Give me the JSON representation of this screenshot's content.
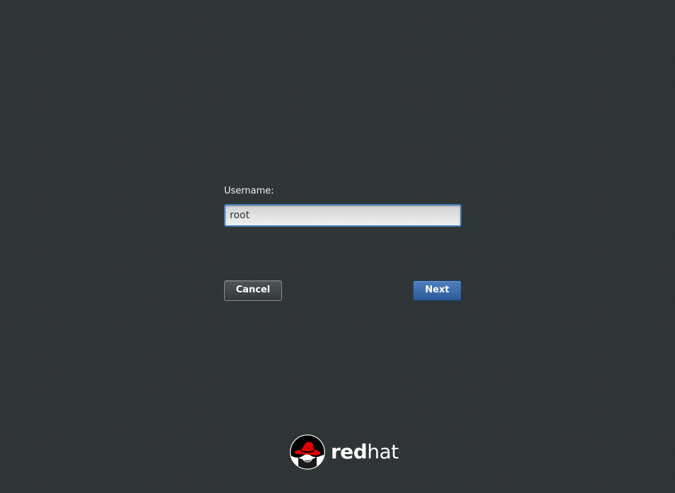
{
  "login": {
    "username_label": "Username:",
    "username_value": "root"
  },
  "buttons": {
    "cancel_label": "Cancel",
    "next_label": "Next"
  },
  "branding": {
    "logo_text_red": "red",
    "logo_text_hat": "hat",
    "logo_tm": ".",
    "logo_icon": "red-hat-shadowman-icon"
  },
  "colors": {
    "background": "#2e3436",
    "focus_border": "#4a7fc0",
    "next_button": "#3a6aa8",
    "logo_red": "#e00000"
  }
}
